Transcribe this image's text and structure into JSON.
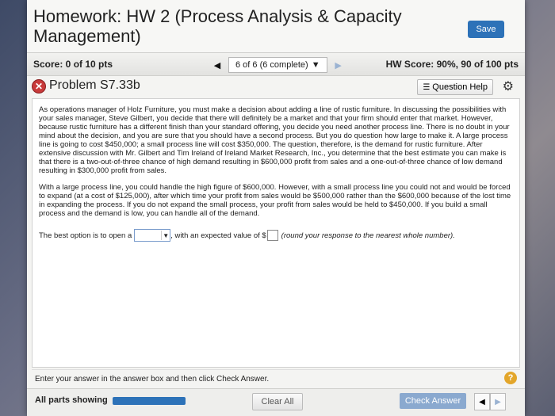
{
  "header": {
    "title": "Homework: HW 2 (Process Analysis & Capacity Management)",
    "save_label": "Save"
  },
  "scorebar": {
    "score": "Score: 0 of 10 pts",
    "position": "6 of 6 (6 complete)",
    "hw_score": "HW Score: 90%, 90 of 100 pts"
  },
  "problem": {
    "title": "Problem S7.33b",
    "help_label": "Question Help"
  },
  "content": {
    "paragraph1": "As operations manager of Holz Furniture, you must make a decision about adding a line of rustic furniture. In discussing the possibilities with your sales manager, Steve Gilbert, you decide that there will definitely be a market and that your firm should enter that market. However, because rustic furniture has a different finish than your standard offering, you decide you need another process line. There is no doubt in your mind about the decision, and you are sure that you should have a second process. But you do question how large to make it. A large process line is going to cost $450,000; a small process line will cost $350,000. The question, therefore, is the demand for rustic furniture. After extensive discussion with Mr. Gilbert and Tim Ireland of Ireland Market Research, Inc., you determine that the best estimate you can make is that there is a two-out-of-three chance of high demand resulting in $600,000 profit from sales and a one-out-of-three chance of low demand resulting in $300,000 profit from sales.",
    "paragraph2": "With a large process line, you could handle the high figure of $600,000. However, with a small process line you could not and would be forced to expand (at a cost of $125,000), after which time your profit from sales would be $500,000 rather than the $600,000 because of the lost time in expanding the process. If you do not expand the small process, your profit from sales would be held to $450,000. If you build a small process and the demand is low, you can handle all of the demand.",
    "answer_prefix": "The best option is to open a",
    "answer_middle": ", with an expected value of $",
    "answer_suffix": "(round your response to the nearest whole number)."
  },
  "footer": {
    "instruction": "Enter your answer in the answer box and then click Check Answer.",
    "all_parts": "All parts showing",
    "progress": 1.0,
    "clear_label": "Clear All",
    "check_label": "Check Answer"
  },
  "icons": {
    "incorrect": "x-circle-icon",
    "help": "question-mark-icon",
    "settings": "gear-icon"
  },
  "colors": {
    "accent": "#2d72b8",
    "error": "#c83a3a",
    "help": "#e3a62a"
  }
}
